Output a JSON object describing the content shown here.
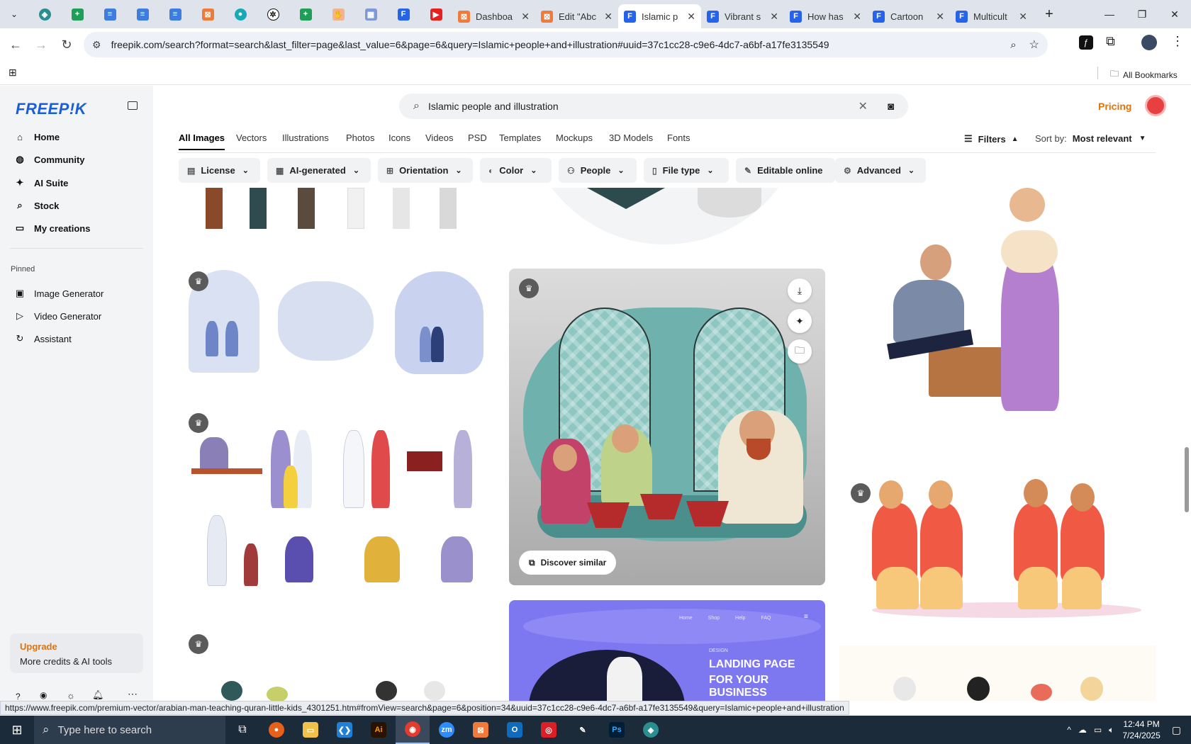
{
  "browser": {
    "pinned_tabs": [
      "app-icon",
      "sheets-icon",
      "docs-icon",
      "docs-icon",
      "docs-icon",
      "canva-icon",
      "chat-icon",
      "chatgpt-icon",
      "sheets-icon",
      "hand-icon",
      "grid-icon",
      "forms-icon",
      "youtube-icon"
    ],
    "tabs": [
      {
        "title": "Dashboa",
        "icon": "canva-icon"
      },
      {
        "title": "Edit \"Abc",
        "icon": "canva-icon"
      },
      {
        "title": "Islamic p",
        "icon": "forms-icon",
        "active": true
      },
      {
        "title": "Vibrant s",
        "icon": "forms-icon"
      },
      {
        "title": "How has",
        "icon": "forms-icon"
      },
      {
        "title": "Cartoon",
        "icon": "forms-icon"
      },
      {
        "title": "Multicult",
        "icon": "forms-icon"
      }
    ],
    "url": "freepik.com/search?format=search&last_filter=page&last_value=6&page=6&query=Islamic+people+and+illustration#uuid=37c1cc28-c9e6-4dc7-a6bf-a17fe3135549",
    "bookmarks_label": "All Bookmarks",
    "status_url": "https://www.freepik.com/premium-vector/arabian-man-teaching-quran-little-kids_4301251.htm#fromView=search&page=6&position=34&uuid=37c1cc28-c9e6-4dc7-a6bf-a17fe3135549&query=Islamic+people+and+illustration"
  },
  "sidebar": {
    "logo": "FREEP!K",
    "main_items": [
      {
        "label": "Home",
        "icon": "home-icon"
      },
      {
        "label": "Community",
        "icon": "globe-icon"
      },
      {
        "label": "AI Suite",
        "icon": "sparkle-icon"
      },
      {
        "label": "Stock",
        "icon": "search-icon"
      },
      {
        "label": "My creations",
        "icon": "folder-icon"
      }
    ],
    "pinned_title": "Pinned",
    "pinned_items": [
      {
        "label": "Image Generator",
        "icon": "image-icon"
      },
      {
        "label": "Video Generator",
        "icon": "video-icon"
      },
      {
        "label": "Assistant",
        "icon": "assistant-icon"
      }
    ],
    "upgrade": {
      "title": "Upgrade",
      "subtitle": "More credits & AI tools"
    }
  },
  "header": {
    "search_value": "Islamic people and illustration",
    "pricing": "Pricing",
    "nav_tabs": [
      "All Images",
      "Vectors",
      "Illustrations",
      "Photos",
      "Icons",
      "Videos",
      "PSD",
      "Templates",
      "Mockups",
      "3D Models",
      "Fonts"
    ],
    "active_tab": "All Images",
    "filters_label": "Filters",
    "sort_label": "Sort by:",
    "sort_value": "Most relevant"
  },
  "filter_chips": [
    {
      "label": "License",
      "icon": "license-icon",
      "dropdown": true
    },
    {
      "label": "AI-generated",
      "icon": "ai-icon",
      "dropdown": true
    },
    {
      "label": "Orientation",
      "icon": "orientation-icon",
      "dropdown": true
    },
    {
      "label": "Color",
      "icon": "palette-icon",
      "dropdown": true
    },
    {
      "label": "People",
      "icon": "people-icon",
      "dropdown": true
    },
    {
      "label": "File type",
      "icon": "file-icon",
      "dropdown": true
    },
    {
      "label": "Editable online",
      "icon": "pen-icon",
      "dropdown": false
    },
    {
      "label": "Advanced",
      "icon": "gear-icon",
      "dropdown": true
    }
  ],
  "results": {
    "discover_similar": "Discover similar",
    "landing_title_1": "LANDING PAGE",
    "landing_title_2": "FOR YOUR BUSINESS",
    "landing_small": "DESIGN",
    "landing_nav": [
      "Home",
      "Shop",
      "Help",
      "FAQ"
    ]
  },
  "taskbar": {
    "search_placeholder": "Type here to search",
    "time": "12:44 PM",
    "date": "7/24/2025"
  }
}
